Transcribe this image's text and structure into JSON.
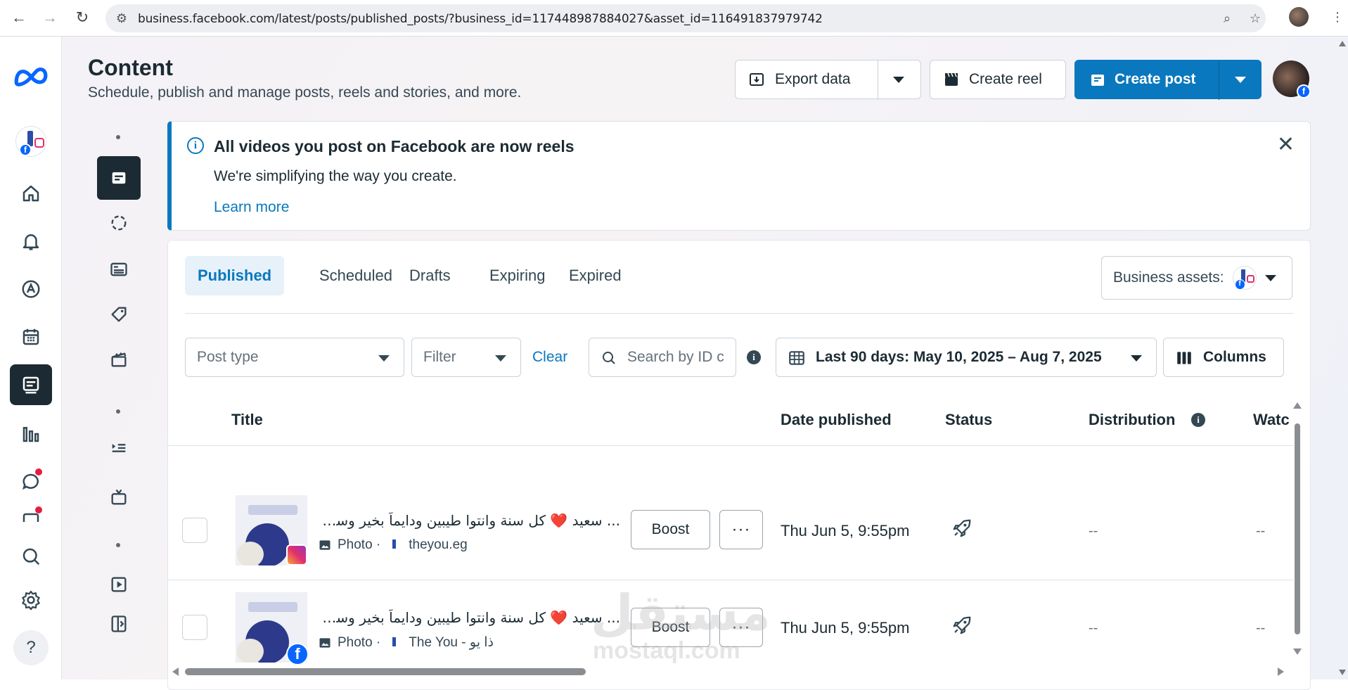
{
  "browser": {
    "url": "business.facebook.com/latest/posts/published_posts/?business_id=117448987884027&asset_id=116491837979742"
  },
  "header": {
    "title": "Content",
    "subtitle": "Schedule, publish and manage posts, reels and stories, and more.",
    "export_label": "Export data",
    "create_reel_label": "Create reel",
    "create_post_label": "Create post"
  },
  "banner": {
    "title": "All videos you post on Facebook are now reels",
    "text": "We're simplifying the way you create.",
    "link": "Learn more"
  },
  "tabs": [
    {
      "label": "Published",
      "active": true
    },
    {
      "label": "Scheduled",
      "active": false
    },
    {
      "label": "Drafts",
      "active": false
    },
    {
      "label": "Expiring",
      "active": false
    },
    {
      "label": "Expired",
      "active": false
    }
  ],
  "business_assets_label": "Business assets:",
  "filters": {
    "post_type_placeholder": "Post type",
    "filter_placeholder": "Filter",
    "clear_label": "Clear",
    "search_placeholder": "Search by ID c",
    "date_range": "Last 90 days: May 10, 2025 – Aug 7, 2025",
    "columns_label": "Columns"
  },
  "table": {
    "columns": [
      "Title",
      "Date published",
      "Status",
      "Distribution",
      "Watc"
    ],
    "rows": [
      {
        "title": "... سعيد ❤️ كل سنة وانتوا طيبين ودايماً بخير وسط حبايبكم",
        "type": "Photo ·",
        "account": "theyou.eg",
        "platform": "instagram",
        "boost": "Boost",
        "more": "···",
        "date": "Thu Jun 5, 9:55pm",
        "distribution": "--",
        "watch": "--"
      },
      {
        "title": "... سعيد ❤️ كل سنة وانتوا طيبين ودايماً بخير وسط حبايبكم",
        "type": "Photo ·",
        "account": "The You - ذا يو",
        "platform": "facebook",
        "boost": "Boost",
        "more": "···",
        "date": "Thu Jun 5, 9:55pm",
        "distribution": "--",
        "watch": "--"
      }
    ]
  },
  "rail_help_label": "?",
  "watermark": {
    "arabic": "مستقل",
    "latin": "mostaql.com"
  },
  "colors": {
    "accent": "#0a78be",
    "dark": "#1c2b33",
    "fb_blue": "#0866ff",
    "alert_red": "#e41e3f"
  }
}
